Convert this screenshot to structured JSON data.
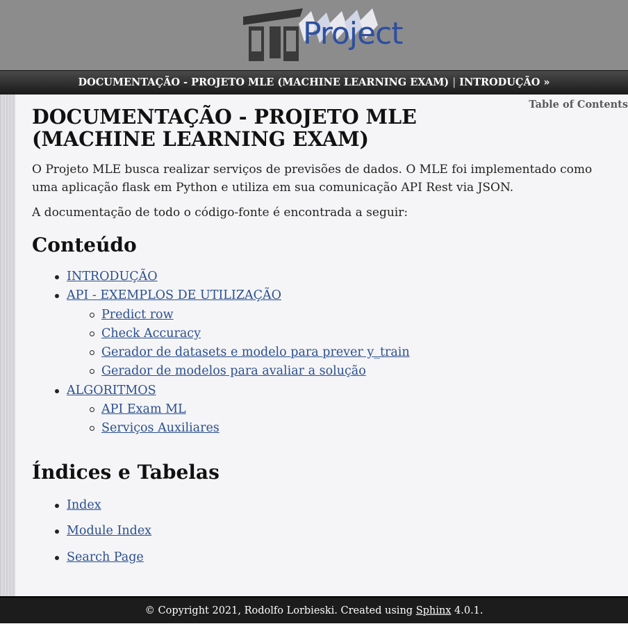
{
  "header": {
    "logo_icon": "project-logo",
    "logo_text": "Project",
    "colors": {
      "background": "#8c8c8c",
      "logo_text": "#2d4fa0"
    }
  },
  "relbar": {
    "title_link": "DOCUMENTAÇÃO - PROJETO MLE (MACHINE LEARNING EXAM)",
    "separator": "|",
    "next_link": "INTRODUÇÃO »"
  },
  "sidebar": {
    "toc_label": "Table of Contents"
  },
  "main": {
    "title": "DOCUMENTAÇÃO - PROJETO MLE (MACHINE LEARNING EXAM)",
    "intro": "O Projeto MLE busca realizar serviços de previsões de dados. O MLE foi implementado como uma aplicação flask em Python e utiliza em sua comunicação API Rest via JSON.",
    "docs_line": "A documentação de todo o código-fonte é encontrada a seguir:",
    "contents_heading": "Conteúdo",
    "contents": [
      {
        "label": "INTRODUÇÃO"
      },
      {
        "label": "API - EXEMPLOS DE UTILIZAÇÃO",
        "children": [
          "Predict row",
          "Check Accuracy",
          "Gerador de datasets e modelo para prever y_train",
          "Gerador de modelos para avaliar a solução"
        ]
      },
      {
        "label": "ALGORITMOS",
        "children": [
          "API Exam ML",
          "Serviços Auxiliares"
        ]
      }
    ],
    "indices_heading": "Índices e Tabelas",
    "indices": [
      "Index",
      "Module Index",
      "Search Page"
    ]
  },
  "footer": {
    "prefix": "© Copyright 2021, Rodolfo Lorbieski. Created using",
    "sphinx_link": "Sphinx",
    "version": "4.0.1."
  }
}
